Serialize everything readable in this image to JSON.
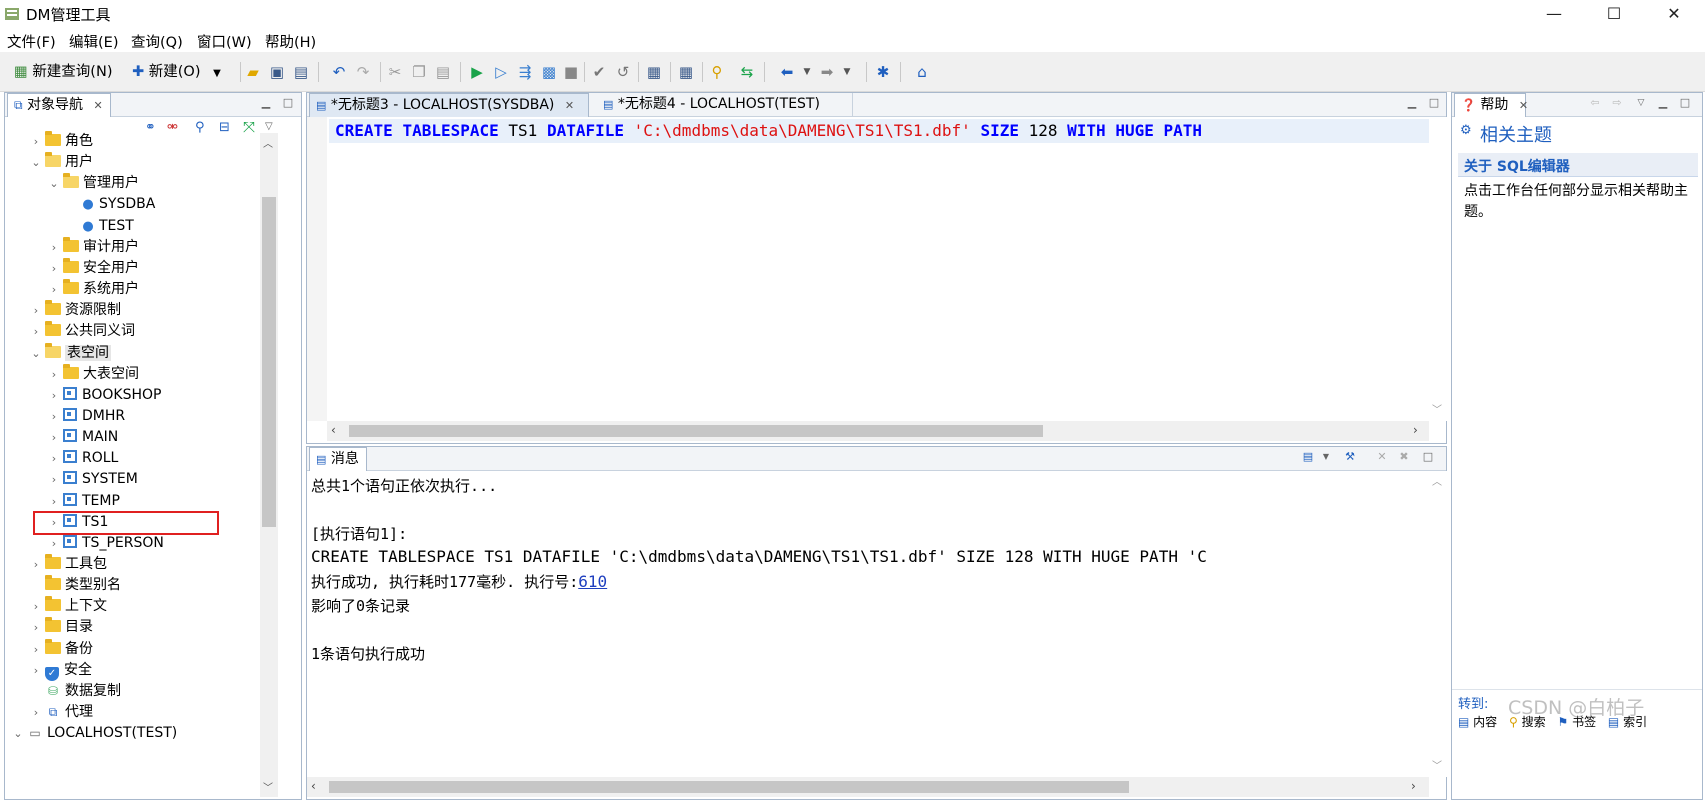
{
  "window": {
    "title": "DM管理工具",
    "controls": {
      "minimize": "—",
      "maximize": "☐",
      "close": "✕"
    }
  },
  "menu": [
    "文件(F)",
    "编辑(E)",
    "查询(Q)",
    "窗口(W)",
    "帮助(H)"
  ],
  "toolbar": {
    "new_query_label": "新建查询(N)",
    "new_label": "新建(O)"
  },
  "navigator": {
    "tab_label": "对象导航",
    "tree": [
      {
        "label": "角色",
        "depth": 0,
        "expanded": false,
        "icon": "folder-icon"
      },
      {
        "label": "用户",
        "depth": 0,
        "expanded": true,
        "icon": "folder-open-icon"
      },
      {
        "label": "管理用户",
        "depth": 1,
        "expanded": true,
        "icon": "folder-open-icon"
      },
      {
        "label": "SYSDBA",
        "depth": 2,
        "leaf": true,
        "icon": "user-icon"
      },
      {
        "label": "TEST",
        "depth": 2,
        "leaf": true,
        "icon": "user-icon"
      },
      {
        "label": "审计用户",
        "depth": 1,
        "expanded": false,
        "icon": "folder-icon"
      },
      {
        "label": "安全用户",
        "depth": 1,
        "expanded": false,
        "icon": "folder-icon"
      },
      {
        "label": "系统用户",
        "depth": 1,
        "expanded": false,
        "icon": "folder-icon"
      },
      {
        "label": "资源限制",
        "depth": 0,
        "expanded": false,
        "icon": "folder-icon"
      },
      {
        "label": "公共同义词",
        "depth": 0,
        "expanded": false,
        "icon": "folder-icon"
      },
      {
        "label": "表空间",
        "depth": 0,
        "expanded": true,
        "icon": "folder-open-icon",
        "selected": true
      },
      {
        "label": "大表空间",
        "depth": 1,
        "expanded": false,
        "icon": "folder-icon"
      },
      {
        "label": "BOOKSHOP",
        "depth": 1,
        "expanded": false,
        "icon": "tablespace-icon"
      },
      {
        "label": "DMHR",
        "depth": 1,
        "expanded": false,
        "icon": "tablespace-icon"
      },
      {
        "label": "MAIN",
        "depth": 1,
        "expanded": false,
        "icon": "tablespace-icon"
      },
      {
        "label": "ROLL",
        "depth": 1,
        "expanded": false,
        "icon": "tablespace-icon"
      },
      {
        "label": "SYSTEM",
        "depth": 1,
        "expanded": false,
        "icon": "tablespace-icon"
      },
      {
        "label": "TEMP",
        "depth": 1,
        "expanded": false,
        "icon": "tablespace-icon"
      },
      {
        "label": "TS1",
        "depth": 1,
        "expanded": false,
        "icon": "tablespace-icon",
        "highlighted": true
      },
      {
        "label": "TS_PERSON",
        "depth": 1,
        "expanded": false,
        "icon": "tablespace-icon"
      },
      {
        "label": "工具包",
        "depth": 0,
        "expanded": false,
        "icon": "folder-icon"
      },
      {
        "label": "类型别名",
        "depth": 0,
        "leaf": true,
        "icon": "folder-icon"
      },
      {
        "label": "上下文",
        "depth": 0,
        "expanded": false,
        "icon": "folder-icon"
      },
      {
        "label": "目录",
        "depth": 0,
        "expanded": false,
        "icon": "folder-icon"
      },
      {
        "label": "备份",
        "depth": 0,
        "expanded": false,
        "icon": "folder-icon"
      },
      {
        "label": "安全",
        "depth": 0,
        "expanded": false,
        "icon": "shield-icon"
      },
      {
        "label": "数据复制",
        "depth": 0,
        "leaf": true,
        "icon": "replication-icon"
      },
      {
        "label": "代理",
        "depth": 0,
        "expanded": false,
        "icon": "agent-icon"
      },
      {
        "label": "LOCALHOST(TEST)",
        "depth": -1,
        "expanded": true,
        "icon": "server-icon"
      }
    ]
  },
  "editor": {
    "tabs": [
      {
        "label": "*无标题3 - LOCALHOST(SYSDBA)",
        "active": true
      },
      {
        "label": "*无标题4 - LOCALHOST(TEST)",
        "active": false
      }
    ],
    "sql_tokens": [
      {
        "t": "CREATE",
        "k": "kw"
      },
      {
        "t": " "
      },
      {
        "t": "TABLESPACE",
        "k": "kw"
      },
      {
        "t": " TS1 "
      },
      {
        "t": "DATAFILE",
        "k": "kw"
      },
      {
        "t": " "
      },
      {
        "t": "'C:\\dmdbms\\data\\DAMENG\\TS1\\TS1.dbf'",
        "k": "str"
      },
      {
        "t": " "
      },
      {
        "t": "SIZE",
        "k": "kw"
      },
      {
        "t": " 128 "
      },
      {
        "t": "WITH",
        "k": "kw"
      },
      {
        "t": " "
      },
      {
        "t": "HUGE",
        "k": "kw"
      },
      {
        "t": " "
      },
      {
        "t": "PATH",
        "k": "kw"
      }
    ]
  },
  "messages": {
    "tab_label": "消息",
    "lines": [
      "总共1个语句正依次执行...",
      "",
      "[执行语句1]:",
      "CREATE TABLESPACE TS1 DATAFILE 'C:\\dmdbms\\data\\DAMENG\\TS1\\TS1.dbf' SIZE 128 WITH HUGE PATH 'C",
      "执行成功, 执行耗时177毫秒. 执行号:",
      "影响了0条记录",
      "",
      "1条语句执行成功"
    ],
    "exec_number": "610"
  },
  "help": {
    "tab_label": "帮助",
    "heading": "相关主题",
    "section_title": "关于 SQL编辑器",
    "body": "点击工作台任何部分显示相关帮助主题。",
    "goto_label": "转到:",
    "footer_links": [
      "内容",
      "搜索",
      "书签",
      "索引"
    ],
    "watermark": "CSDN @白柏子"
  },
  "colors": {
    "keyword": "#0000ff",
    "string": "#dd1111",
    "accent": "#1f5fbf",
    "highlight_box": "#e02020"
  }
}
